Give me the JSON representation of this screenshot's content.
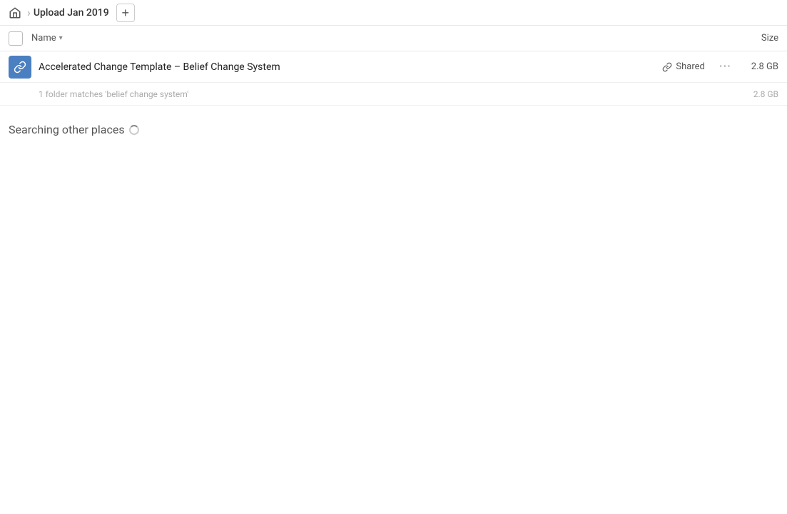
{
  "header": {
    "title": "Upload Jan 2019",
    "add_button_label": "+",
    "home_icon": "home-icon"
  },
  "columns": {
    "name_label": "Name",
    "size_label": "Size"
  },
  "file_row": {
    "name": "Accelerated Change Template – Belief Change System",
    "shared_label": "Shared",
    "size": "2.8 GB",
    "more_icon": "more-options-icon",
    "link_icon": "link-icon",
    "file_icon": "file-icon"
  },
  "match_info": {
    "text": "1 folder matches 'belief change system'",
    "size": "2.8 GB"
  },
  "searching": {
    "label": "Searching other places",
    "spinner": true
  }
}
